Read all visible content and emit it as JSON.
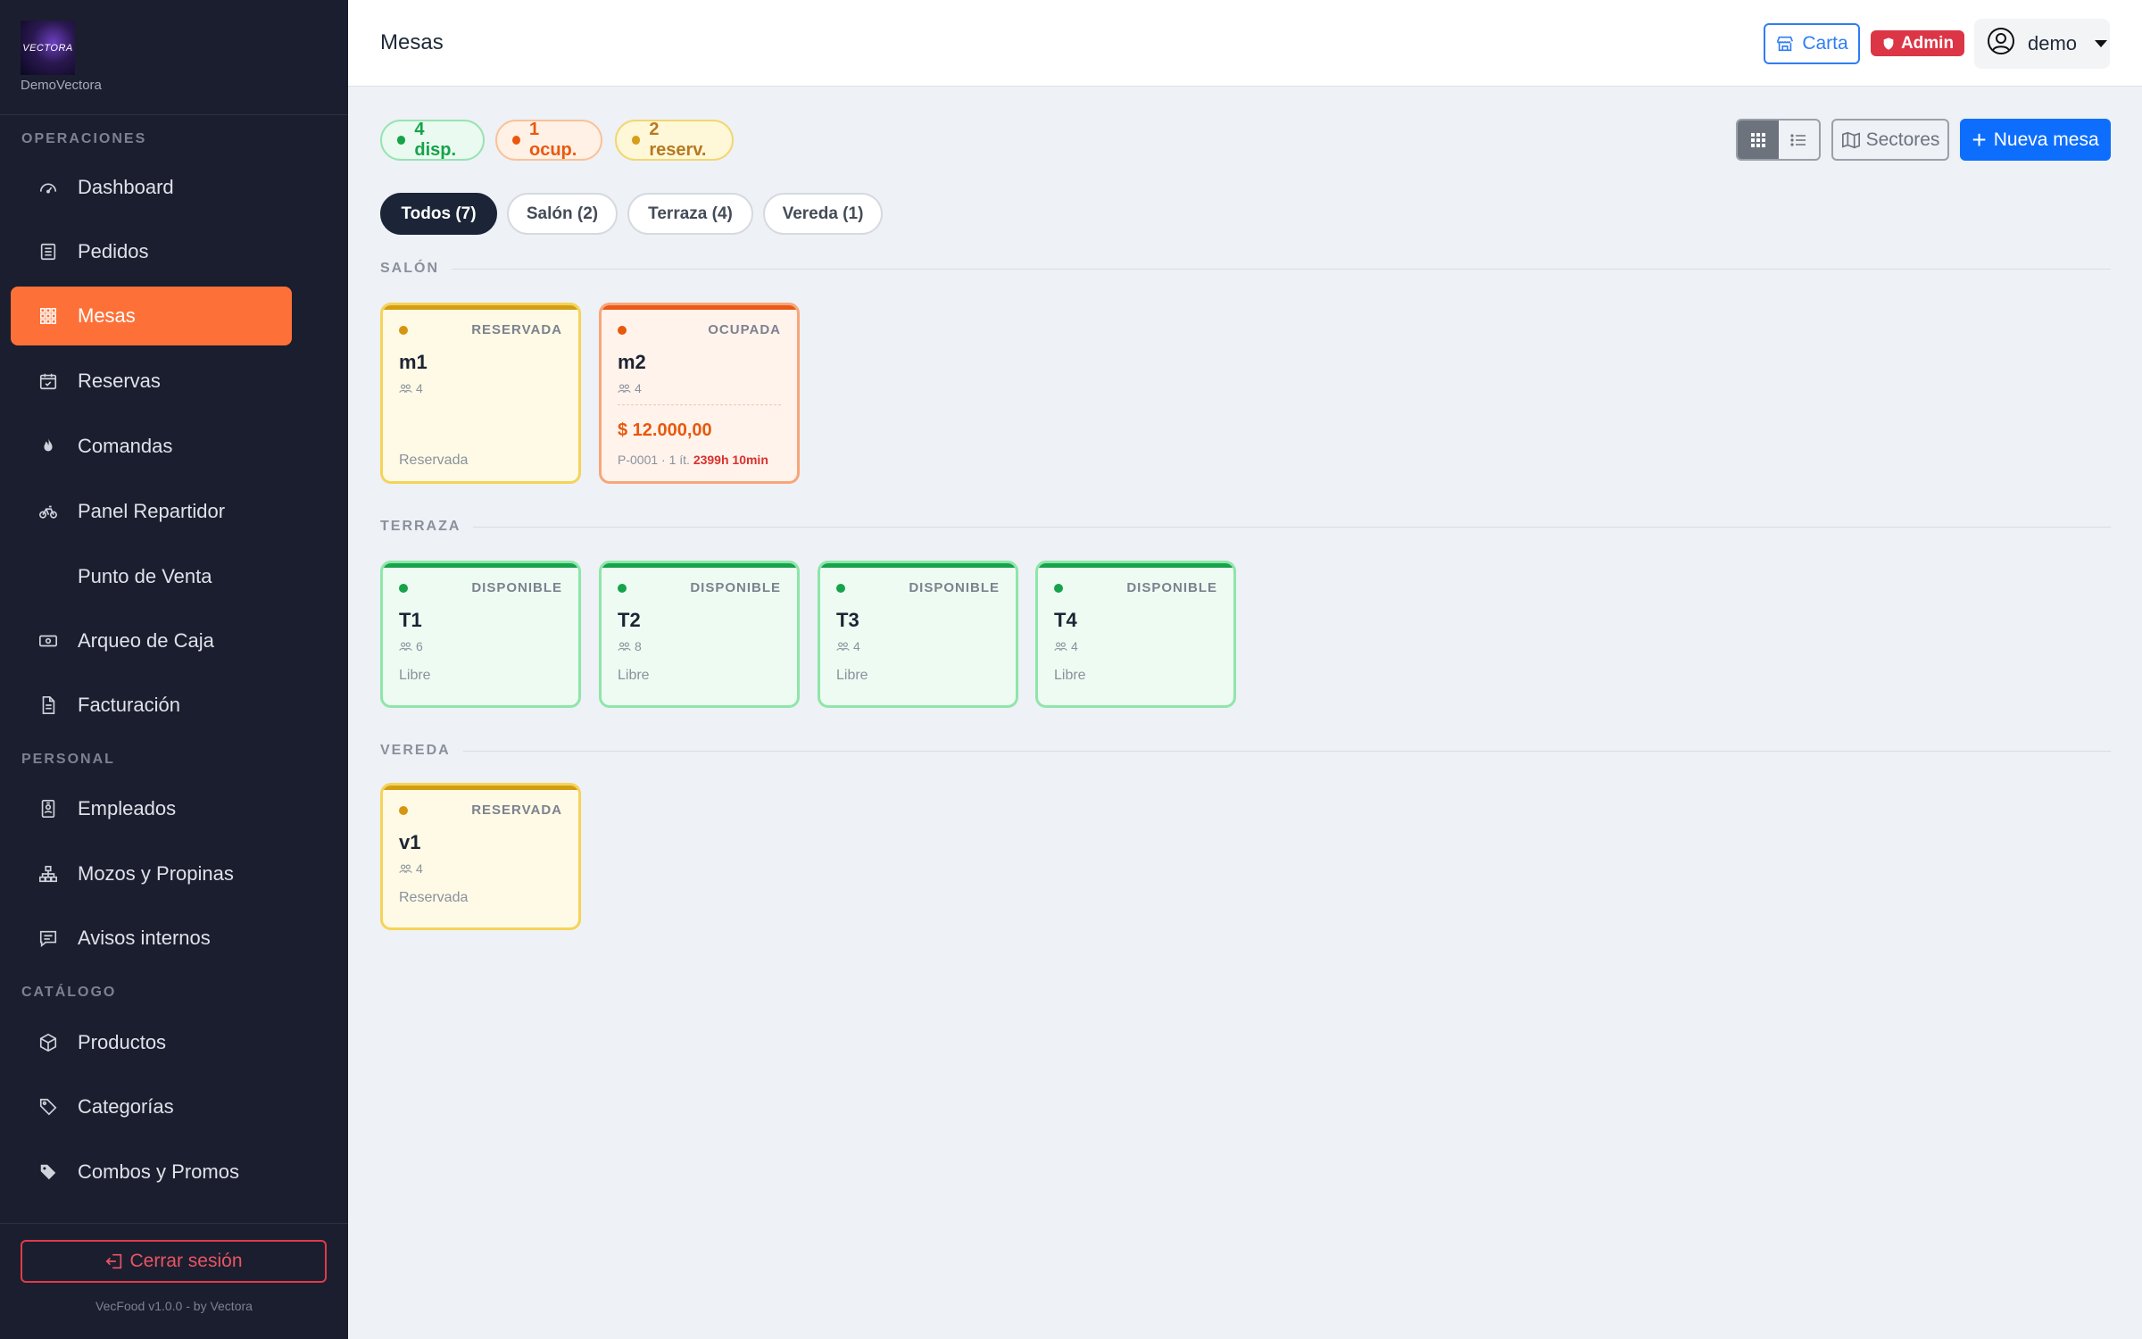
{
  "brand": {
    "logo_text": "VECTORA",
    "name": "DemoVectora"
  },
  "sidebar": {
    "sections": {
      "operaciones": "OPERACIONES",
      "personal": "PERSONAL",
      "catalogo": "CATÁLOGO"
    },
    "items": {
      "dashboard": {
        "label": "Dashboard",
        "icon": "speedometer-icon"
      },
      "pedidos": {
        "label": "Pedidos",
        "icon": "receipt-icon"
      },
      "mesas": {
        "label": "Mesas",
        "icon": "grid-icon",
        "active": true
      },
      "reservas": {
        "label": "Reservas",
        "icon": "calendar-check-icon"
      },
      "comandas": {
        "label": "Comandas",
        "icon": "fire-icon"
      },
      "repartidor": {
        "label": "Panel Repartidor",
        "icon": "bicycle-icon"
      },
      "pos": {
        "label": "Punto de Venta",
        "icon": "none"
      },
      "arqueo": {
        "label": "Arqueo de Caja",
        "icon": "cash-icon"
      },
      "facturacion": {
        "label": "Facturación",
        "icon": "document-icon"
      },
      "empleados": {
        "label": "Empleados",
        "icon": "person-badge-icon"
      },
      "mozos": {
        "label": "Mozos y Propinas",
        "icon": "diagram-icon"
      },
      "avisos": {
        "label": "Avisos internos",
        "icon": "chat-icon"
      },
      "productos": {
        "label": "Productos",
        "icon": "box-icon"
      },
      "categorias": {
        "label": "Categorías",
        "icon": "tags-icon"
      },
      "combos": {
        "label": "Combos y Promos",
        "icon": "tag-icon"
      }
    },
    "logout_label": "Cerrar sesión",
    "version": "VecFood v1.0.0 - by Vectora"
  },
  "header": {
    "title": "Mesas",
    "carta_label": "Carta",
    "admin_label": "Admin",
    "user_name": "demo"
  },
  "summary": {
    "disponibles": "4 disp.",
    "ocupadas": "1 ocup.",
    "reservadas": "2 reserv."
  },
  "toolbar": {
    "sectores_label": "Sectores",
    "nueva_label": "Nueva mesa"
  },
  "filters": [
    "Todos (7)",
    "Salón (2)",
    "Terraza (4)",
    "Vereda (1)"
  ],
  "sections": {
    "salon": {
      "title": "SALÓN",
      "tables": [
        {
          "name": "m1",
          "status": "RESERVADA",
          "capacity": "4",
          "note": "Reservada"
        },
        {
          "name": "m2",
          "status": "OCUPADA",
          "capacity": "4",
          "amount": "$ 12.000,00",
          "order": "P-0001 · 1 ít.",
          "time": "2399h 10min"
        }
      ]
    },
    "terraza": {
      "title": "TERRAZA",
      "tables": [
        {
          "name": "T1",
          "status": "DISPONIBLE",
          "capacity": "6",
          "note": "Libre"
        },
        {
          "name": "T2",
          "status": "DISPONIBLE",
          "capacity": "8",
          "note": "Libre"
        },
        {
          "name": "T3",
          "status": "DISPONIBLE",
          "capacity": "4",
          "note": "Libre"
        },
        {
          "name": "T4",
          "status": "DISPONIBLE",
          "capacity": "4",
          "note": "Libre"
        }
      ]
    },
    "vereda": {
      "title": "VEREDA",
      "tables": [
        {
          "name": "v1",
          "status": "RESERVADA",
          "capacity": "4",
          "note": "Reservada"
        }
      ]
    }
  },
  "colors": {
    "accent": "#fd7139",
    "primary": "#0d6efd",
    "sidebar_bg": "#1b1e2e",
    "disponible": "#16a34a",
    "ocupada": "#ea580c",
    "reservada": "#d69e1a",
    "danger": "#dc3545"
  }
}
